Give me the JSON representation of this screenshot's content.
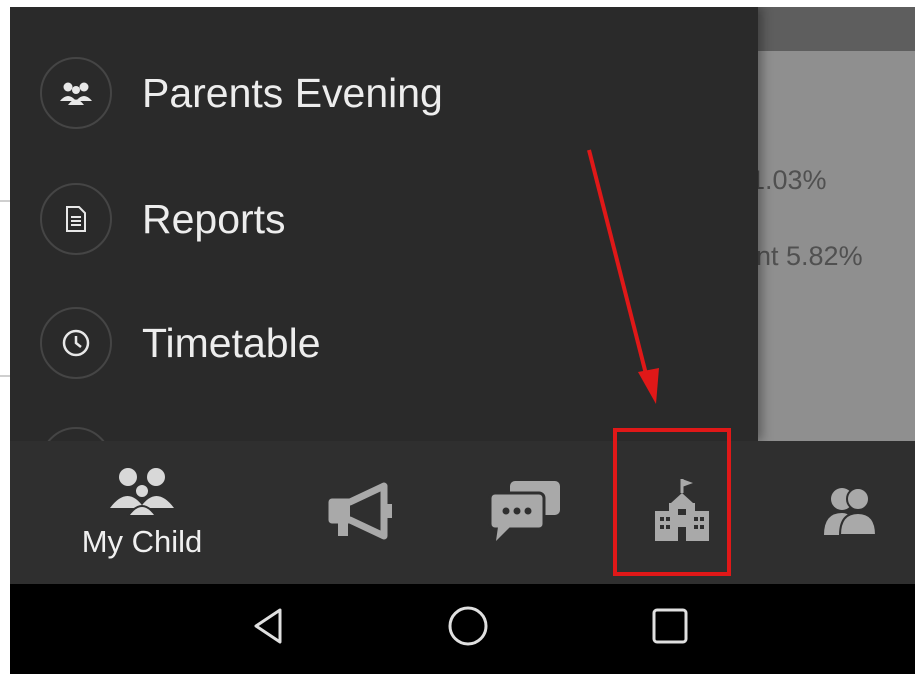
{
  "drawer": {
    "items": [
      {
        "label": "Parents Evening",
        "icon": "parents-group-icon"
      },
      {
        "label": "Reports",
        "icon": "document-icon"
      },
      {
        "label": "Timetable",
        "icon": "clock-icon"
      }
    ]
  },
  "background": {
    "line1": "1.03%",
    "line2": "nt 5.82%"
  },
  "tabbar": {
    "tabs": [
      {
        "label": "My Child",
        "icon": "children-icon"
      },
      {
        "label": "",
        "icon": "megaphone-icon"
      },
      {
        "label": "",
        "icon": "chat-icon"
      },
      {
        "label": "",
        "icon": "school-icon"
      },
      {
        "label": "",
        "icon": "contacts-icon"
      }
    ]
  },
  "navbar": {
    "buttons": [
      "back-icon",
      "home-icon",
      "recents-icon"
    ]
  },
  "colors": {
    "annotation": "#e01818",
    "drawer_bg": "#2a2a2a",
    "tabbar_bg": "#2f2f2f"
  }
}
